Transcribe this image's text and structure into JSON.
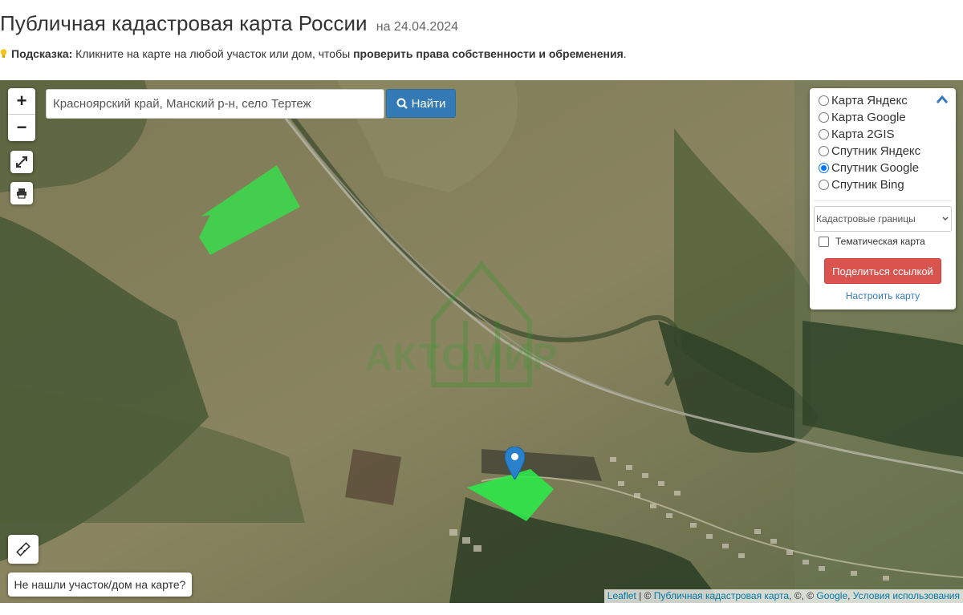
{
  "header": {
    "title": "Публичная кадастровая карта России",
    "date": "на 24.04.2024"
  },
  "hint": {
    "label": "Подсказка:",
    "text": " Кликните на карте на любой участок или дом, чтобы ",
    "bold_text": "проверить права собственности и обременения",
    "end": "."
  },
  "map": {
    "zoom_in": "+",
    "zoom_out": "−",
    "search": {
      "value": "Красноярский край, Манский р-н, село Тертеж",
      "button_label": "Найти"
    },
    "layers": {
      "options": [
        {
          "label": "Карта Яндекс",
          "selected": false
        },
        {
          "label": "Карта Google",
          "selected": false
        },
        {
          "label": "Карта 2GIS",
          "selected": false
        },
        {
          "label": "Спутник Яндекс",
          "selected": false
        },
        {
          "label": "Спутник Google",
          "selected": true
        },
        {
          "label": "Спутник Bing",
          "selected": false
        }
      ],
      "overlay_select": "Кадастровые границы",
      "thematic_label": "Тематическая карта",
      "share_label": "Поделиться ссылкой",
      "configure_label": "Настроить карту"
    },
    "not_found_label": "Не нашли участок/дом на карте?",
    "attribution": {
      "leaflet": "Leaflet",
      "sep1": " | © ",
      "pkk": "Публичная кадастровая карта",
      "sep2": ", ©, © ",
      "google": "Google",
      "sep3": ", ",
      "terms": "Условия использования"
    },
    "watermark": "АКТОМИР"
  },
  "colors": {
    "parcel_fill": "#2ee84a",
    "marker": "#2a81cb",
    "primary_button": "#337ab7",
    "danger_button": "#d9534f",
    "link": "#337ab7"
  }
}
